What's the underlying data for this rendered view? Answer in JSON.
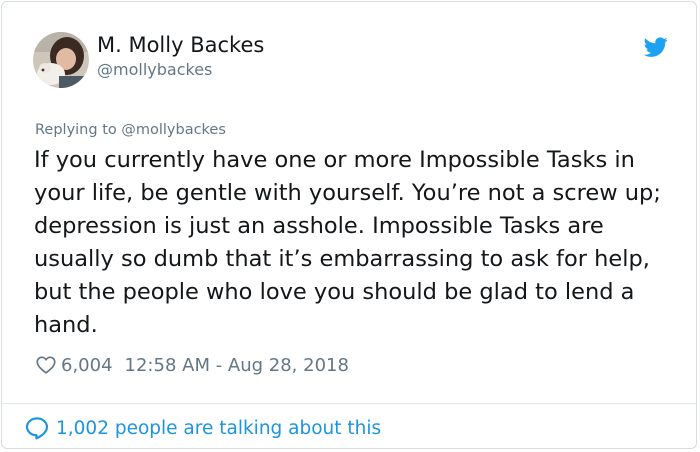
{
  "author": {
    "display_name": "M. Molly Backes",
    "handle": "@mollybackes"
  },
  "icons": {
    "brand": "twitter-bird-icon",
    "like": "heart-icon",
    "reply": "speech-bubble-icon"
  },
  "colors": {
    "brand_blue": "#1da1f2",
    "link_blue": "#1b95e0",
    "text": "#14171a",
    "muted": "#657786"
  },
  "tweet": {
    "replying_to": "Replying to @mollybackes",
    "text": "If you currently have one or more Impossible Tasks in your life, be gentle with yourself. You’re not a screw up; depression is just an asshole. Impossible Tasks are usually so dumb that it’s embarrassing to ask for help, but the people who love you should be glad to lend a hand.",
    "likes": "6,004",
    "timestamp": "12:58 AM - Aug 28, 2018"
  },
  "footer": {
    "talking_label": "1,002 people are talking about this"
  }
}
